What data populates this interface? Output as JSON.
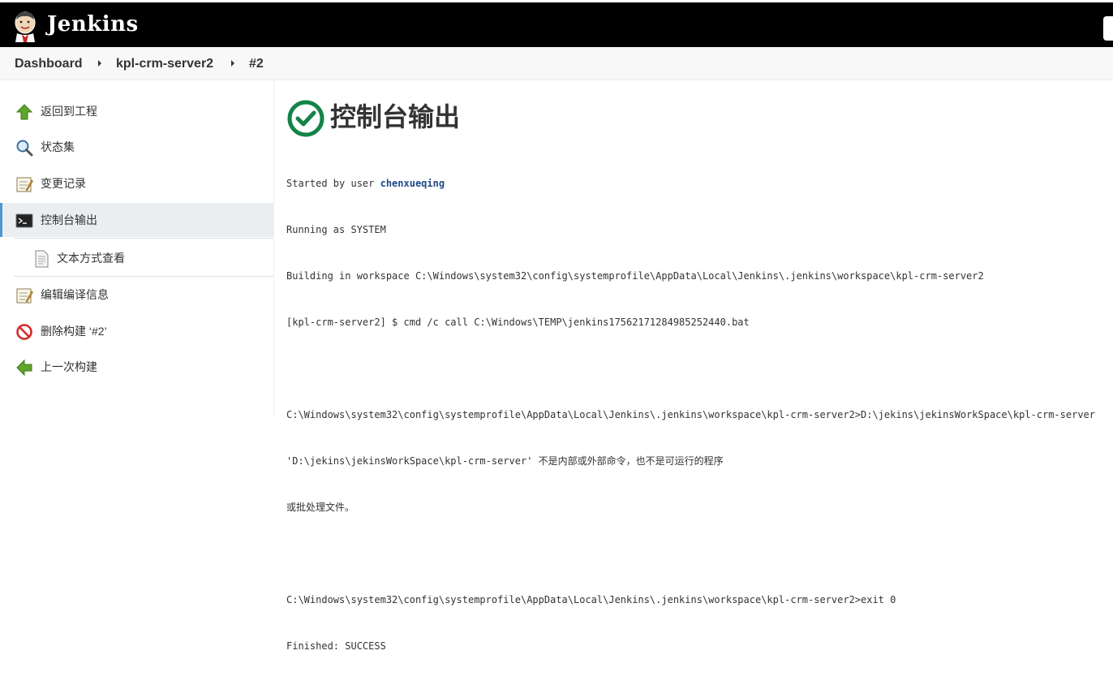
{
  "header": {
    "brand": "Jenkins",
    "logo_icon": "jenkins-butler-logo",
    "background": "#000000"
  },
  "breadcrumb": {
    "items": [
      "Dashboard",
      "kpl-crm-server2",
      "#2"
    ]
  },
  "sidebar": {
    "items": [
      {
        "label": "返回到工程",
        "icon": "arrow-up-icon"
      },
      {
        "label": "状态集",
        "icon": "magnifier-icon"
      },
      {
        "label": "变更记录",
        "icon": "notepad-icon"
      },
      {
        "label": "控制台输出",
        "icon": "terminal-icon",
        "active": true
      },
      {
        "label": "文本方式查看",
        "icon": "document-icon"
      },
      {
        "label": "编辑编译信息",
        "icon": "notepad-icon"
      },
      {
        "label": "删除构建 ‘#2’",
        "icon": "no-entry-icon"
      },
      {
        "label": "上一次构建",
        "icon": "arrow-left-icon"
      }
    ]
  },
  "main": {
    "title": "控制台输出",
    "status": "success",
    "status_color": "#138347",
    "console": {
      "started_prefix": "Started by user ",
      "user": "chenxueqing",
      "lines": [
        "Running as SYSTEM",
        "Building in workspace C:\\Windows\\system32\\config\\systemprofile\\AppData\\Local\\Jenkins\\.jenkins\\workspace\\kpl-crm-server2",
        "[kpl-crm-server2] $ cmd /c call C:\\Windows\\TEMP\\jenkins1756217128498525​2440.bat",
        "",
        "C:\\Windows\\system32\\config\\systemprofile\\AppData\\Local\\Jenkins\\.jenkins\\workspace\\kpl-crm-server2>D:\\jekins\\jekinsWorkSpace\\kpl-crm-server",
        "'D:\\jekins\\jekinsWorkSpace\\kpl-crm-server' 不是内部或外部命令，也不是可运行的程序",
        "或批处理文件。",
        "",
        "C:\\Windows\\system32\\config\\systemprofile\\AppData\\Local\\Jenkins\\.jenkins\\workspace\\kpl-crm-server2>exit 0",
        "Finished: SUCCESS"
      ]
    }
  }
}
